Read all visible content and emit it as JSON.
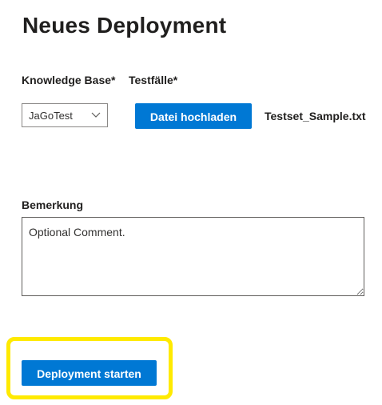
{
  "page": {
    "title": "Neues Deployment"
  },
  "form": {
    "knowledge_base_label": "Knowledge Base*",
    "knowledge_base_value": "JaGoTest",
    "testfaelle_label": "Testfälle*",
    "upload_button_label": "Datei hochladen",
    "uploaded_filename": "Testset_Sample.txt",
    "bemerkung_label": "Bemerkung",
    "bemerkung_placeholder": "Optional Comment."
  },
  "actions": {
    "start_button_label": "Deployment starten"
  },
  "colors": {
    "primary": "#0078d4",
    "highlight": "#ffea00"
  },
  "icons": {
    "dropdown": "chevron-down-icon"
  }
}
